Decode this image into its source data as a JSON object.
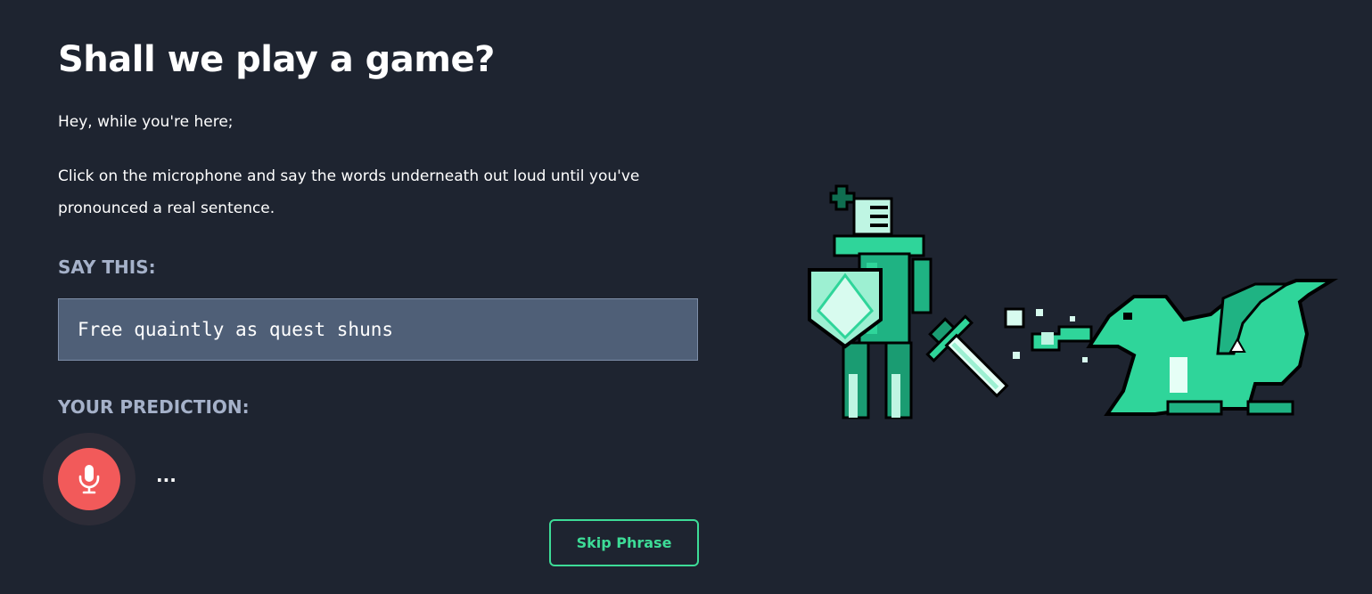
{
  "header": {
    "title": "Shall we play a game?"
  },
  "intro": "Hey, while you're here;",
  "instructions": "Click on the microphone and say the words underneath out loud until you've pronounced a real sentence.",
  "say_this": {
    "label": "SAY THIS:",
    "phrase": "Free quaintly as quest shuns"
  },
  "prediction": {
    "label": "YOUR PREDICTION:",
    "value": "..."
  },
  "buttons": {
    "skip_label": "Skip Phrase"
  },
  "icons": {
    "mic": "microphone-icon"
  },
  "colors": {
    "background": "#1e2430",
    "accent": "#3ddc97",
    "mic": "#f25a5a",
    "label": "#a5b1c9",
    "phrase_box": "#4f5f77"
  }
}
